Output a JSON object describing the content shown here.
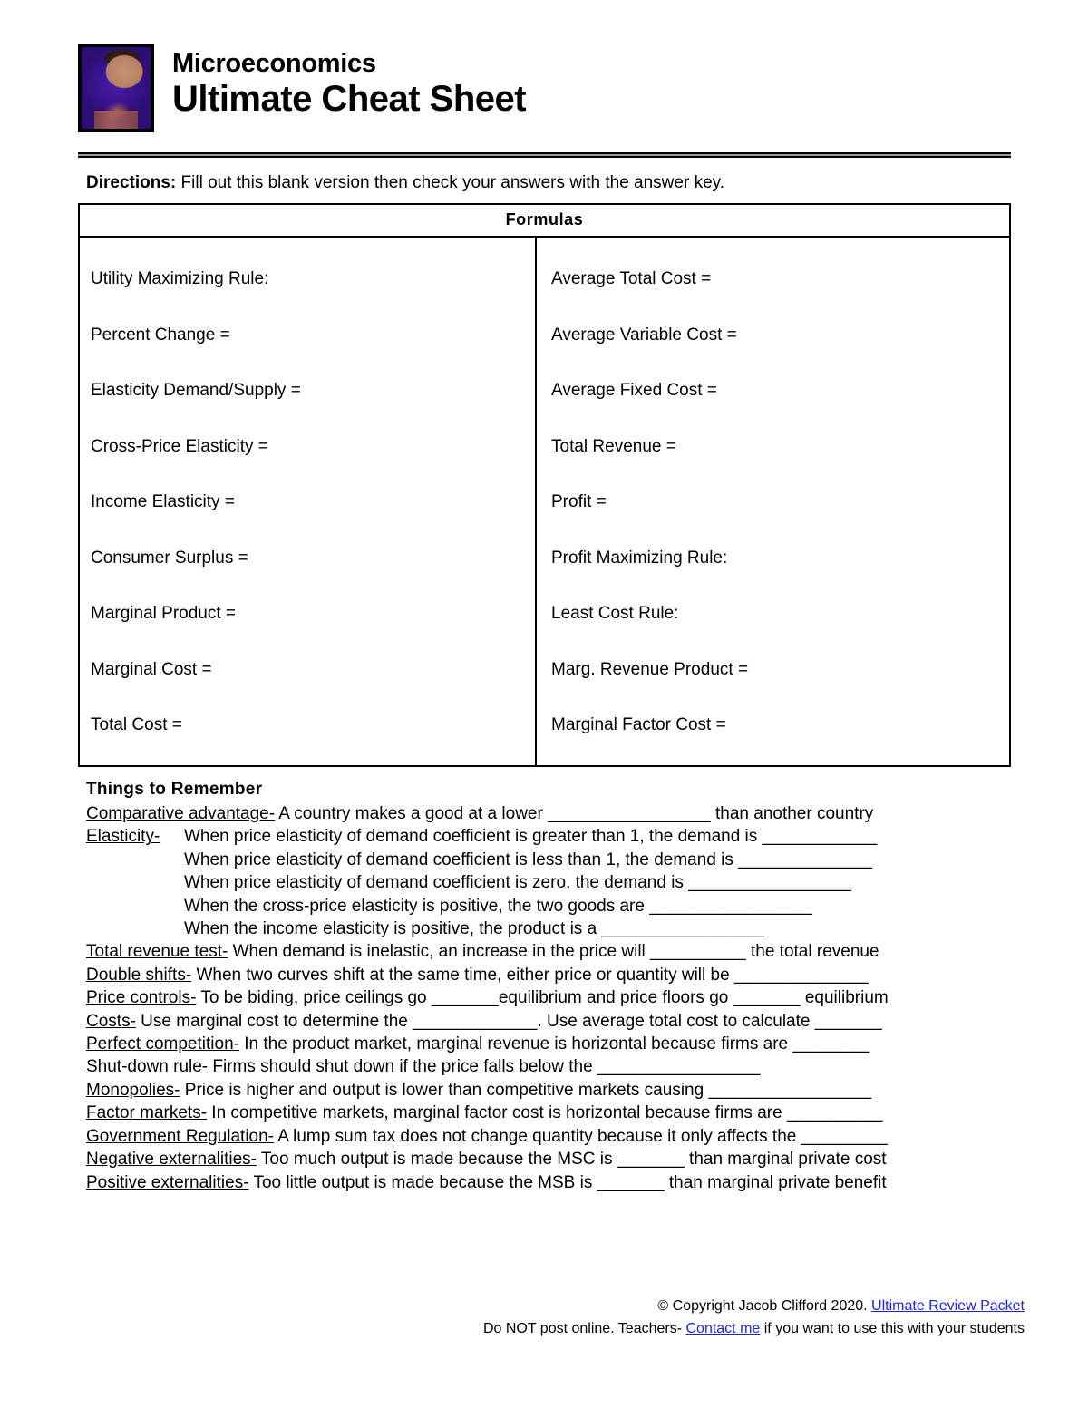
{
  "header": {
    "avatar_alt": "jacob-clifford-avatar",
    "subtitle": "Microeconomics",
    "title": "Ultimate Cheat Sheet"
  },
  "directions": {
    "label": "Directions:",
    "text": " Fill out this blank version then check your answers with the answer key."
  },
  "formulas": {
    "heading": "Formulas",
    "left": [
      "Utility Maximizing Rule:",
      "Percent Change =",
      "Elasticity Demand/Supply =",
      "Cross-Price Elasticity =",
      "Income Elasticity =",
      "Consumer Surplus =",
      "Marginal Product =",
      "Marginal Cost =",
      "Total Cost ="
    ],
    "right": [
      "Average Total Cost =",
      "Average Variable Cost =",
      "Average Fixed Cost =",
      "Total Revenue =",
      "Profit =",
      "Profit Maximizing Rule:",
      "Least Cost Rule:",
      "Marg. Revenue Product =",
      "Marginal Factor Cost ="
    ]
  },
  "things_to_remember": {
    "heading": "Things to Remember",
    "comparative": {
      "term": "Comparative advantage-",
      "text": " A country makes a good at a lower _________________ than another country"
    },
    "elasticity": {
      "term": "Elasticity-",
      "lines": [
        "When price elasticity of demand coefficient is greater than 1, the demand is ____________",
        "When price elasticity of demand coefficient is less than 1, the demand is ______________",
        "When price elasticity of demand coefficient is zero, the demand is _________________",
        "When the cross-price elasticity is positive, the two goods are _________________",
        "When the income elasticity is positive, the product is a _________________"
      ]
    },
    "items": [
      {
        "term": "Total revenue test-",
        "text": " When demand is inelastic, an increase in the price will __________ the total revenue"
      },
      {
        "term": "Double shifts-",
        "text": " When two curves shift at the same time, either price or quantity will be ______________"
      },
      {
        "term": "Price controls-",
        "text": " To be biding, price ceilings go _______equilibrium and price floors go _______ equilibrium"
      },
      {
        "term": "Costs-",
        "text": " Use marginal cost to determine the _____________. Use average total cost to calculate _______"
      },
      {
        "term": "Perfect competition-",
        "text": " In the product market, marginal revenue is horizontal because firms are ________"
      },
      {
        "term": "Shut-down rule-",
        "text": " Firms should shut down if the price falls below the _________________"
      },
      {
        "term": "Monopolies-",
        "text": " Price is higher and output is lower than competitive markets causing _________________"
      },
      {
        "term": "Factor markets-",
        "text": " In competitive markets, marginal factor cost is horizontal because firms are __________"
      },
      {
        "term": "Government Regulation-",
        "text": " A lump sum tax does not change quantity because it only affects the _________"
      },
      {
        "term": "Negative externalities-",
        "text": " Too much output is made because the MSC is _______ than marginal private cost"
      },
      {
        "term": "Positive externalities-",
        "text": " Too little output is made because the MSB is _______ than marginal private benefit"
      }
    ]
  },
  "footer": {
    "copyright_text": "© Copyright Jacob Clifford 2020. ",
    "link_packet": "Ultimate Review Packet",
    "line2_before": "Do NOT post online. Teachers- ",
    "link_contact": "Contact me",
    "line2_after": " if you want to use this with your students"
  }
}
